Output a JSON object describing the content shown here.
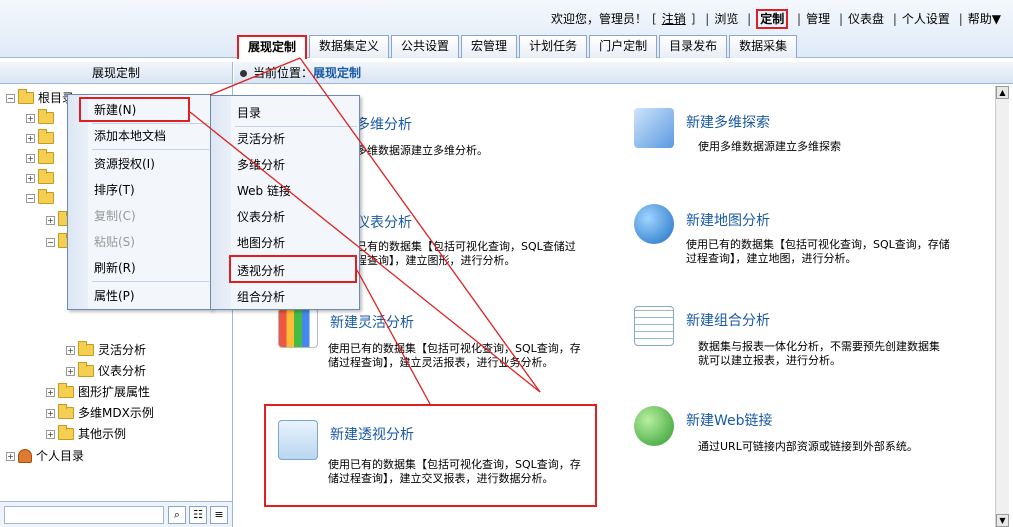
{
  "header": {
    "welcome": "欢迎您，管理员！",
    "logout": "注销",
    "links": [
      "浏览",
      "定制",
      "管理",
      "仪表盘",
      "个人设置"
    ],
    "help": "帮助▼"
  },
  "tabs": [
    "展现定制",
    "数据集定义",
    "公共设置",
    "宏管理",
    "计划任务",
    "门户定制",
    "目录发布",
    "数据采集"
  ],
  "left": {
    "title": "展现定制",
    "tree": {
      "root": "根目录",
      "flex": "灵活分析",
      "dashboard": "仪表分析",
      "graph": "图形扩展属性",
      "mdx": "多维MDX示例",
      "other": "其他示例",
      "personal": "个人目录"
    }
  },
  "context_menu": [
    "新建(N)",
    "添加本地文档",
    "资源授权(I)",
    "排序(T)",
    "复制(C)",
    "粘贴(S)",
    "刷新(R)",
    "属性(P)"
  ],
  "submenu": [
    "目录",
    "灵活分析",
    "多维分析",
    "Web 链接",
    "仪表分析",
    "地图分析",
    "透视分析",
    "组合分析"
  ],
  "breadcrumb": {
    "label": "当前位置：",
    "current": "展现定制"
  },
  "cards": {
    "olap": {
      "title": "多维分析",
      "desc": "多维数据源建立多维分析。"
    },
    "explore": {
      "title": "新建多维探索",
      "desc": "使用多维数据源建立多维探索"
    },
    "dash": {
      "title": "仪表分析",
      "desc": "已有的数据集【包括可视化查询，SQL查储过程查询】，建立图形，进行分析。"
    },
    "map": {
      "title": "新建地图分析",
      "desc": "使用已有的数据集【包括可视化查询，SQL查询，存储过程查询】，建立地图，进行分析。"
    },
    "flex": {
      "title": "新建灵活分析",
      "desc": "使用已有的数据集【包括可视化查询，SQL查询，存储过程查询】，建立灵活报表，进行业务分析。"
    },
    "combo": {
      "title": "新建组合分析",
      "desc": "数据集与报表一体化分析，不需要预先创建数据集就可以建立报表，进行分析。"
    },
    "pivot": {
      "title": "新建透视分析",
      "desc": "使用已有的数据集【包括可视化查询，SQL查询，存储过程查询】，建立交叉报表，进行数据分析。"
    },
    "web": {
      "title": "新建Web链接",
      "desc": "通过URL可链接内部资源或链接到外部系统。"
    }
  }
}
